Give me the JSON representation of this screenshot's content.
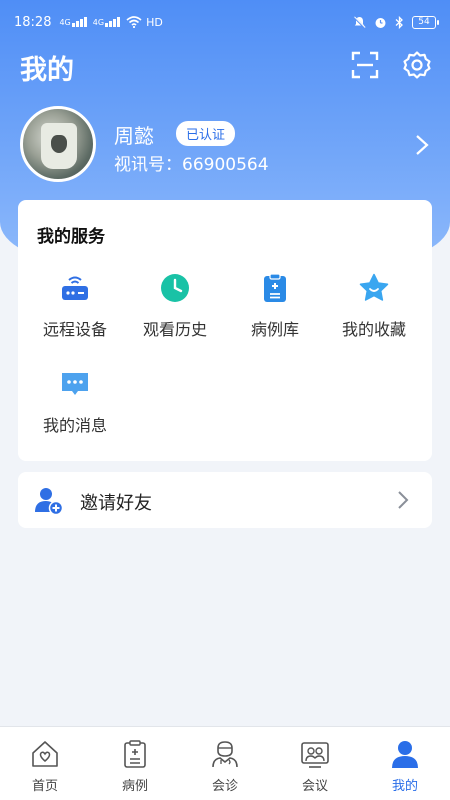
{
  "status_bar": {
    "time": "18:28",
    "signal1": "4G",
    "signal2": "4G",
    "network": "HD",
    "battery": "54"
  },
  "header": {
    "title": "我的",
    "scan_icon": "scan-icon",
    "settings_icon": "gear-icon"
  },
  "profile": {
    "name": "周懿",
    "badge": "已认证",
    "id_text": "视讯号：66900564"
  },
  "services": {
    "title": "我的服务",
    "items": [
      {
        "label": "远程设备",
        "icon": "router-icon",
        "color": "#2f6fe4"
      },
      {
        "label": "观看历史",
        "icon": "clock-icon",
        "color": "#19c2a6"
      },
      {
        "label": "病例库",
        "icon": "clipboard-icon",
        "color": "#2a8ae6"
      },
      {
        "label": "我的收藏",
        "icon": "star-icon",
        "color": "#3aa6f0"
      },
      {
        "label": "我的消息",
        "icon": "message-icon",
        "color": "#4da2ee"
      }
    ]
  },
  "invite": {
    "label": "邀请好友",
    "icon": "add-user-icon"
  },
  "tabbar": {
    "items": [
      {
        "label": "首页",
        "icon": "home-icon"
      },
      {
        "label": "病例",
        "icon": "case-icon"
      },
      {
        "label": "会诊",
        "icon": "doctor-icon"
      },
      {
        "label": "会议",
        "icon": "meeting-icon"
      },
      {
        "label": "我的",
        "icon": "person-icon"
      }
    ],
    "active_index": 4
  },
  "colors": {
    "accent": "#2a6ee8",
    "header_gradient_top": "#4f8ef6",
    "header_gradient_bottom": "#8db9fb",
    "background": "#f1f4f9"
  }
}
